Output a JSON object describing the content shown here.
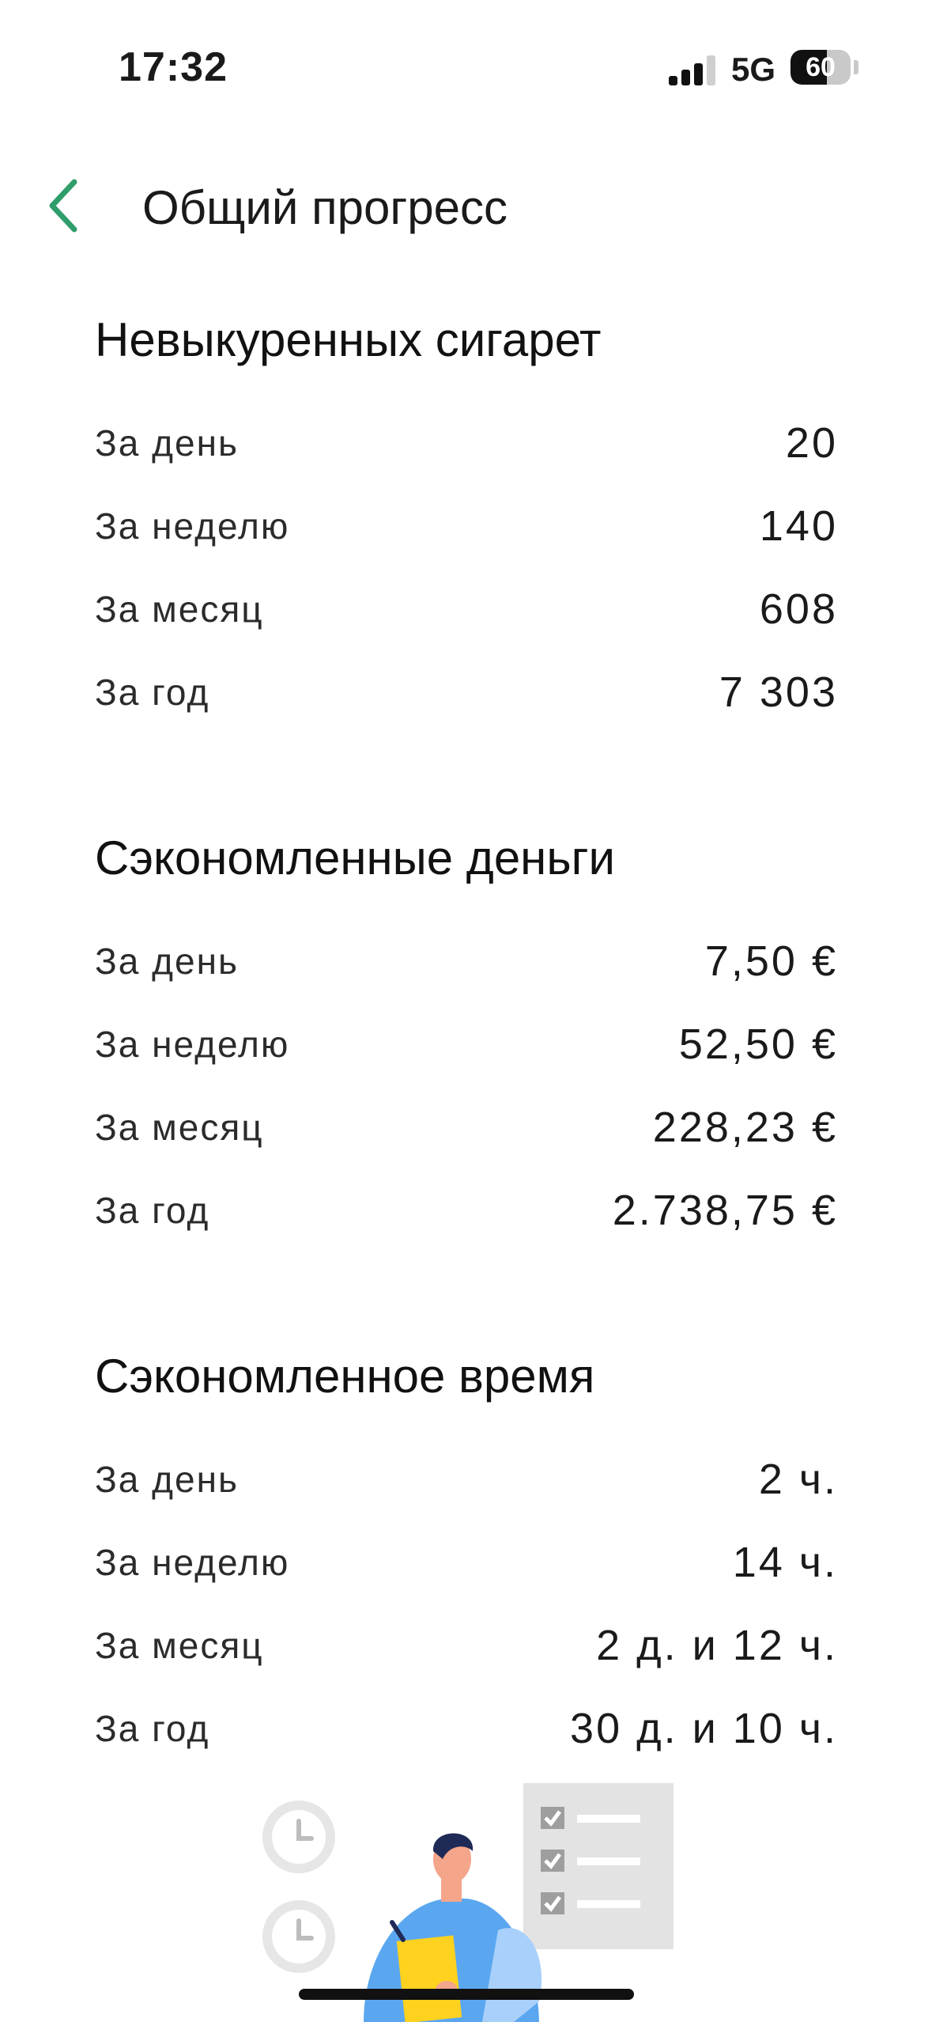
{
  "status_bar": {
    "time": "17:32",
    "network": "5G",
    "battery_percent": "60",
    "battery_level": 0.6
  },
  "header": {
    "title": "Общий прогресс",
    "back_icon": "chevron-left-icon",
    "accent_color": "#2f9e6b"
  },
  "sections": [
    {
      "title": "Невыкуренных сигарет",
      "rows": [
        {
          "label": "За день",
          "value": "20"
        },
        {
          "label": "За неделю",
          "value": "140"
        },
        {
          "label": "За месяц",
          "value": "608"
        },
        {
          "label": "За год",
          "value": "7 303"
        }
      ]
    },
    {
      "title": "Сэкономленные деньги",
      "rows": [
        {
          "label": "За день",
          "value": "7,50 €"
        },
        {
          "label": "За неделю",
          "value": "52,50 €"
        },
        {
          "label": "За месяц",
          "value": "228,23 €"
        },
        {
          "label": "За год",
          "value": "2.738,75 €"
        }
      ]
    },
    {
      "title": "Сэкономленное время",
      "rows": [
        {
          "label": "За день",
          "value": "2 ч."
        },
        {
          "label": "За неделю",
          "value": "14 ч."
        },
        {
          "label": "За месяц",
          "value": "2 д. и 12 ч."
        },
        {
          "label": "За год",
          "value": "30 д. и 10 ч."
        }
      ]
    }
  ]
}
